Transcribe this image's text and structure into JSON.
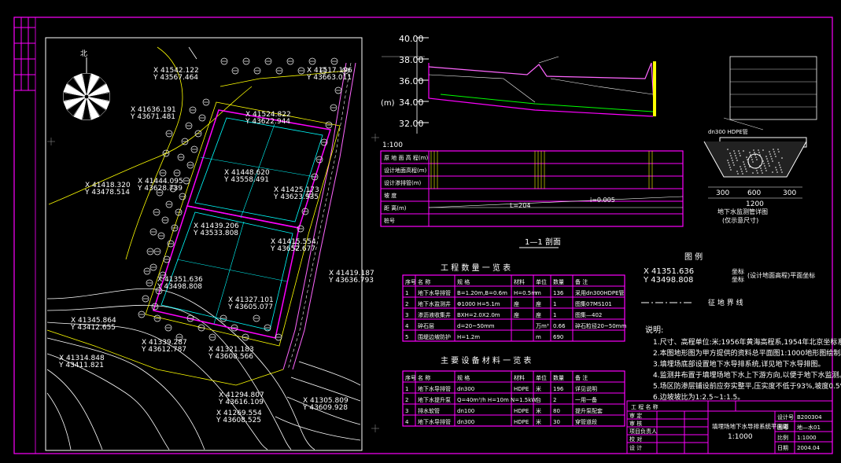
{
  "colors": {
    "background": "#000000",
    "frame": "#ff00ff",
    "text": "#ffffff",
    "yellow": "#ffff00",
    "cyan": "#00ffff",
    "green": "#00ff00",
    "red": "#ff0000",
    "blue": "#3366ff"
  },
  "compass_label": "北",
  "scale_label": "1:100",
  "section": {
    "title": "1—1 剖面",
    "elev_ticks": [
      "40.00",
      "38.00",
      "36.00",
      "34.00",
      "32.00"
    ],
    "unit": "(m)",
    "slope_label": "i=0.005",
    "length_label": "L=204",
    "row_labels": [
      "原 地 面 高 程(m)",
      "设计地面高程(m)",
      "设计渗排管(m)",
      "坡 度",
      "距 离(m)",
      "桩号"
    ]
  },
  "detail": {
    "title": "地下水监测管详图",
    "subtitle": "(仅示意尺寸)",
    "dims": [
      "300",
      "600",
      "300",
      "1200"
    ],
    "pipe_label": "dn300 HDPE管"
  },
  "legend": {
    "title": "图  例",
    "coord_x": "X  41351.636",
    "coord_y": "Y  43498.808",
    "label_x": "坐标",
    "label_y": "坐标",
    "extra": "(设计地面高程)平面坐标",
    "boundary": "征  地  界  线"
  },
  "notes": {
    "title": "说明:",
    "items": [
      "1.尺寸、高程单位:米;1956年黄海高程系,1954年北京坐标系。",
      "2.本图地形图为甲方提供的资料总平面图1:1000地形图绘制。",
      "3.填埋场底部设置地下水导排系统,详见地下水导排图。",
      "4.监测井布置于填埋场地下水上下游方向,以便于地下水监测。",
      "5.场区防渗层铺设前应夯实整平,压实度不低于93%,坡度0.5%。",
      "6.边坡坡比为1:2.5~1:1.5。"
    ]
  },
  "table1": {
    "title": "工 程 数 量 一 览 表",
    "headers": [
      "序号",
      "名  称",
      "规  格",
      "材料",
      "单位",
      "数量",
      "备  注"
    ],
    "rows": [
      [
        "1",
        "地下水导排管",
        "B=1.20m,B=0.6m",
        "H=0.5m",
        "m",
        "136",
        "采用dn300HDPE管"
      ],
      [
        "2",
        "地下水监测井",
        "Φ1000  H=5.1m",
        "座",
        "座",
        "1",
        "图集07MS101"
      ],
      [
        "3",
        "渗沥液收集井",
        "BXH=2.0X2.0m",
        "座",
        "座",
        "1",
        "图集—402"
      ],
      [
        "4",
        "碎石层",
        "d=20~50mm",
        "",
        "万m³",
        "0.66",
        "碎石粒径20~50mm"
      ],
      [
        "5",
        "围堤边坡防护",
        "H=1.2m",
        "",
        "m",
        "690",
        ""
      ]
    ]
  },
  "table2": {
    "title": "主 要 设 备 材 料 一 览 表",
    "headers": [
      "序号",
      "名  称",
      "规  格",
      "材料",
      "单位",
      "数量",
      "备  注"
    ],
    "rows": [
      [
        "1",
        "地下水导排管",
        "dn300",
        "HDPE",
        "米",
        "196",
        "详见说明"
      ],
      [
        "2",
        "地下水提升泵",
        "Q=40m³/h  H=10m  N=1.5kW",
        "",
        "台",
        "2",
        "一用一备"
      ],
      [
        "3",
        "排水软管",
        "dn100",
        "HDPE",
        "米",
        "80",
        "提升泵配套"
      ],
      [
        "4",
        "地下水导排管",
        "dn300",
        "HDPE",
        "米",
        "30",
        "穿管道段"
      ]
    ]
  },
  "title_block": {
    "project_label": "工 程 名 称",
    "drawing_title": "填埋场地下水导排系统平面图",
    "scale": "1:1000",
    "date": "2004.04",
    "rows": [
      "审 定",
      "审 核",
      "项目负责人",
      "校 对",
      "设 计"
    ],
    "right": [
      "设计号",
      "图号",
      "比例",
      "日期"
    ],
    "right_values": [
      "B200304",
      "地—水01",
      "1:1000",
      "2004.04"
    ]
  },
  "plan_labels": [
    {
      "text": "X  41542.122",
      "color": "white"
    },
    {
      "text": "Y  43567.464",
      "color": "white"
    },
    {
      "text": "X  41517.196",
      "color": "white"
    },
    {
      "text": "Y  43663.011",
      "color": "white"
    },
    {
      "text": "X  41524.822",
      "color": "white"
    },
    {
      "text": "Y  43622.944",
      "color": "white"
    },
    {
      "text": "X  41448.620",
      "color": "white"
    },
    {
      "text": "Y  43558.491",
      "color": "white"
    },
    {
      "text": "X  41425.173",
      "color": "white"
    },
    {
      "text": "Y  43623.935",
      "color": "white"
    },
    {
      "text": "X  41439.206",
      "color": "white"
    },
    {
      "text": "Y  43533.808",
      "color": "white"
    },
    {
      "text": "X  41415.554",
      "color": "white"
    },
    {
      "text": "Y  43652.677",
      "color": "white"
    },
    {
      "text": "X  41351.636",
      "color": "white"
    },
    {
      "text": "Y  43498.808",
      "color": "white"
    },
    {
      "text": "X  41327.101",
      "color": "white"
    },
    {
      "text": "Y  43605.077",
      "color": "white"
    },
    {
      "text": "X  41418.320",
      "color": "white"
    },
    {
      "text": "Y  43478.514",
      "color": "white"
    },
    {
      "text": "X  41444.095",
      "color": "white"
    },
    {
      "text": "Y  43628.739",
      "color": "white"
    },
    {
      "text": "X  41345.864",
      "color": "white"
    },
    {
      "text": "Y  43412.655",
      "color": "white"
    },
    {
      "text": "X  41339.287",
      "color": "white"
    },
    {
      "text": "Y  43612.787",
      "color": "white"
    },
    {
      "text": "X  41321.183",
      "color": "white"
    },
    {
      "text": "Y  43608.566",
      "color": "white"
    },
    {
      "text": "X  41314.848",
      "color": "white"
    },
    {
      "text": "Y  43411.821",
      "color": "white"
    },
    {
      "text": "X  41294.807",
      "color": "white"
    },
    {
      "text": "Y  43616.109",
      "color": "white"
    },
    {
      "text": "X  41305.809",
      "color": "white"
    },
    {
      "text": "Y  43609.928",
      "color": "white"
    },
    {
      "text": "X  41269.554",
      "color": "white"
    },
    {
      "text": "Y  43608.525",
      "color": "white"
    },
    {
      "text": "X  41419.187",
      "color": "white"
    },
    {
      "text": "Y  43636.793",
      "color": "white"
    },
    {
      "text": "X  41636.191",
      "color": "white"
    },
    {
      "text": "Y  43671.481",
      "color": "white"
    }
  ]
}
